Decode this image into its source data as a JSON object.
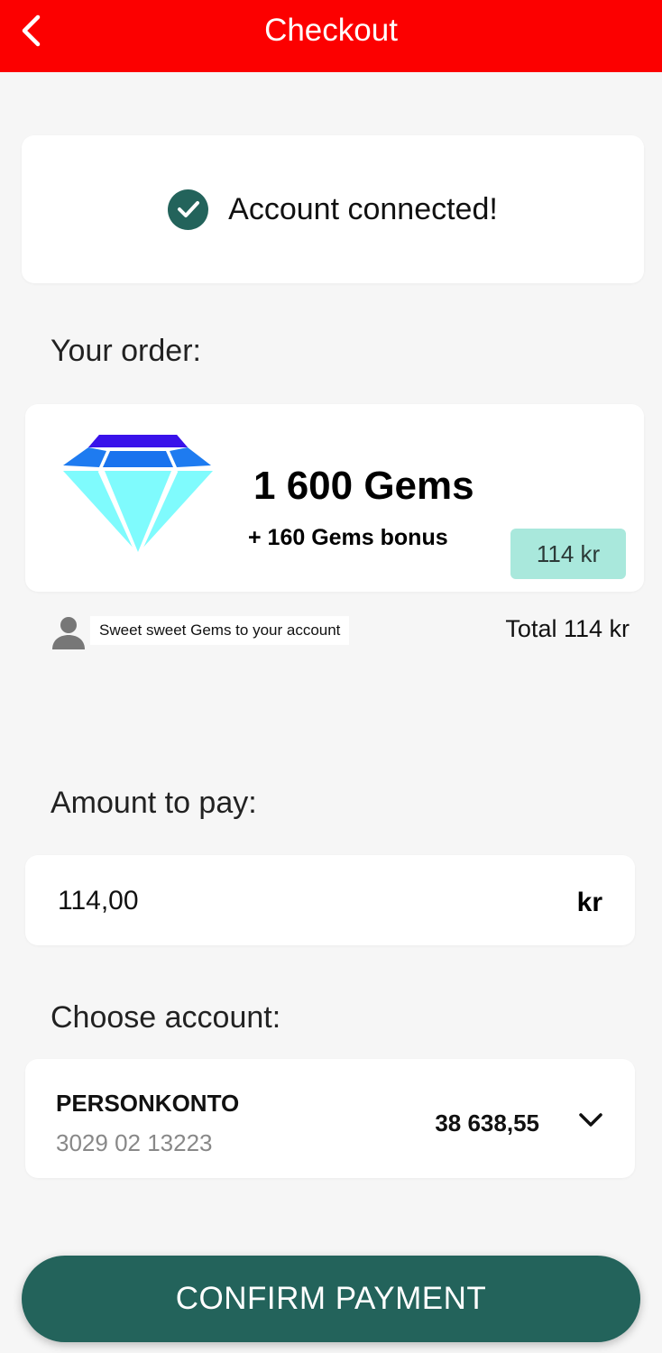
{
  "header": {
    "title": "Checkout",
    "back_icon": "chevron-left-icon",
    "bg_color": "#fc0000"
  },
  "status": {
    "icon": "check-circle-icon",
    "text": "Account connected!",
    "icon_color": "#23635b"
  },
  "order": {
    "label": "Your order:",
    "product_icon": "diamond-gem-icon",
    "title": "1 600 Gems",
    "bonus": "+ 160 Gems bonus",
    "price": "114 kr",
    "price_badge_color": "#a9e8dc"
  },
  "recipient": {
    "icon": "person-icon",
    "note": "Sweet sweet Gems to your account",
    "total": "Total 114 kr"
  },
  "payment": {
    "label": "Amount to pay:",
    "value": "114,00",
    "currency": "kr"
  },
  "account": {
    "label": "Choose account:",
    "name": "PERSONKONTO",
    "number": "3029 02 13223",
    "balance": "38 638,55",
    "dropdown_icon": "chevron-down-icon"
  },
  "confirm": {
    "label": "CONFIRM PAYMENT",
    "color": "#23635b"
  }
}
